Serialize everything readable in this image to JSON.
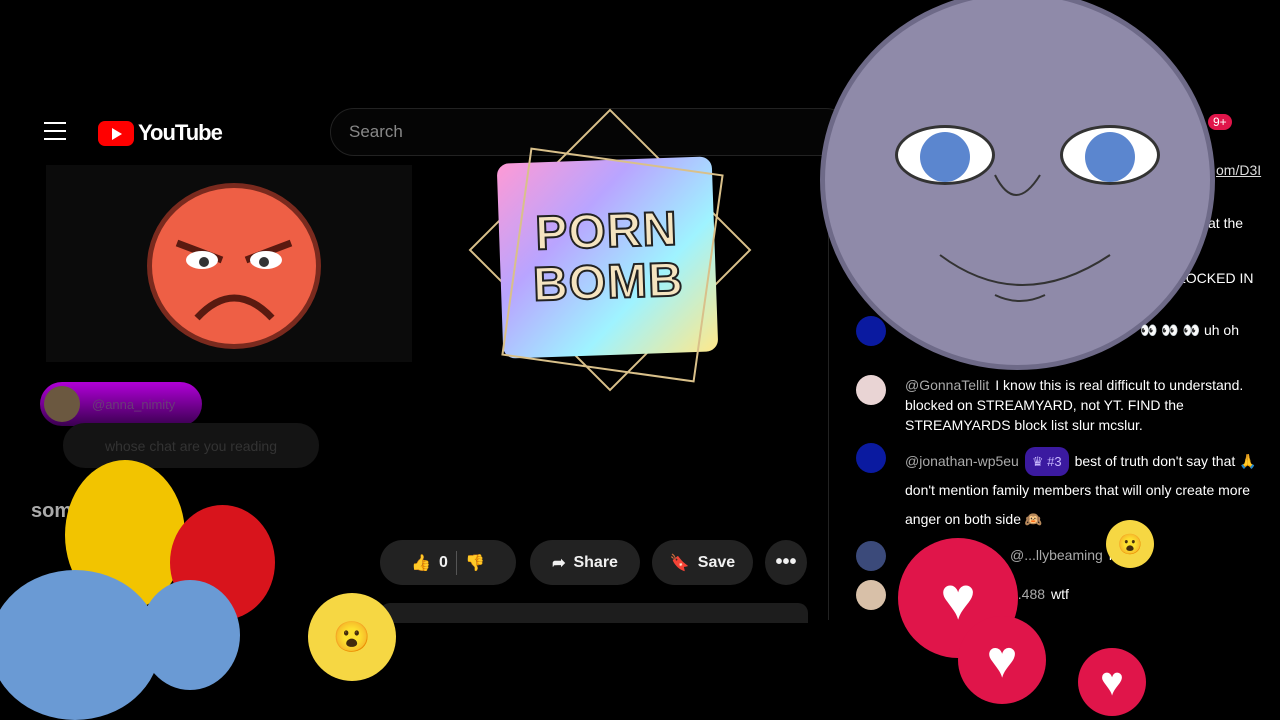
{
  "header": {
    "logo_text": "YouTube",
    "search_placeholder": "Search",
    "notification_badge": "9+",
    "channel_link": "om/D3I"
  },
  "sticker": {
    "line1": "PORN",
    "line2": "BOMB"
  },
  "overlay_chat": {
    "username": "@anna_nimity",
    "message": "whose chat are you reading"
  },
  "section_heading": "som",
  "actions": {
    "like_count": "0",
    "share": "Share",
    "save": "Save",
    "more": "•••"
  },
  "chat": {
    "messages": [
      {
        "user": "",
        "text": "at the"
      },
      {
        "user": "",
        "text": "LOCKED IN"
      },
      {
        "user": "",
        "text": "👀 👀 👀 uh oh"
      },
      {
        "user": "@GonnaTellit",
        "text": "I know this is real difficult to understand. blocked on STREAMYARD, not YT. FIND the STREAMYARDS block list slur mcslur."
      },
      {
        "user": "@jonathan-wp5eu",
        "badge": "#3",
        "text": "best of truth don't say that 🙏 don't mention family members that will only create more anger on both side 🙉"
      },
      {
        "user": "@...llybeaming",
        "text": "lol"
      },
      {
        "user": "...488",
        "text": "wtf"
      }
    ]
  },
  "colors": {
    "youtube_red": "#ff0000",
    "heart": "#e0154a",
    "moon": "#8f8aa9",
    "angry": "#ee5f45"
  }
}
